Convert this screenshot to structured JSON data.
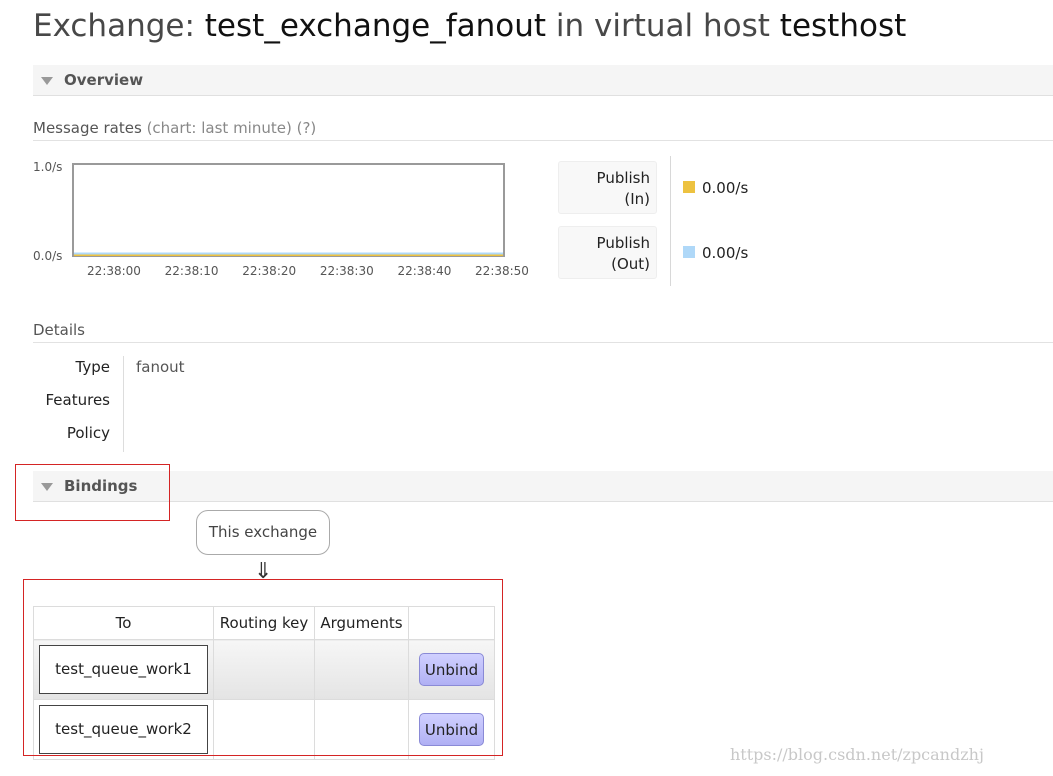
{
  "title": {
    "prefix": "Exchange:",
    "exchange_name": "test_exchange_fanout",
    "middle": "in virtual host",
    "vhost": "testhost"
  },
  "overview": {
    "header": "Overview",
    "message_rates": {
      "label": "Message rates",
      "chart_hint": "(chart: last minute)",
      "help": "(?)"
    },
    "legend": [
      {
        "line1": "Publish",
        "line2": "(In)",
        "value": "0.00/s",
        "color": "#edc240"
      },
      {
        "line1": "Publish",
        "line2": "(Out)",
        "value": "0.00/s",
        "color": "#afd8f8"
      }
    ]
  },
  "chart_data": {
    "type": "line",
    "x": [
      "22:38:00",
      "22:38:10",
      "22:38:20",
      "22:38:30",
      "22:38:40",
      "22:38:50"
    ],
    "y_ticks": [
      "1.0/s",
      "0.0/s"
    ],
    "ylim": [
      0,
      1
    ],
    "series": [
      {
        "name": "Publish (In)",
        "values": [
          0,
          0,
          0,
          0,
          0,
          0
        ],
        "color": "#edc240"
      },
      {
        "name": "Publish (Out)",
        "values": [
          0,
          0,
          0,
          0,
          0,
          0
        ],
        "color": "#afd8f8"
      }
    ]
  },
  "details": {
    "header": "Details",
    "rows": [
      {
        "key": "Type",
        "value": "fanout"
      },
      {
        "key": "Features",
        "value": ""
      },
      {
        "key": "Policy",
        "value": ""
      }
    ]
  },
  "bindings": {
    "header": "Bindings",
    "source_label": "This exchange",
    "arrow": "⇓",
    "columns": [
      "To",
      "Routing key",
      "Arguments",
      ""
    ],
    "rows": [
      {
        "to": "test_queue_work1",
        "routing_key": "",
        "arguments": "",
        "action": "Unbind"
      },
      {
        "to": "test_queue_work2",
        "routing_key": "",
        "arguments": "",
        "action": "Unbind"
      }
    ]
  },
  "watermark": "https://blog.csdn.net/zpcandzhj"
}
